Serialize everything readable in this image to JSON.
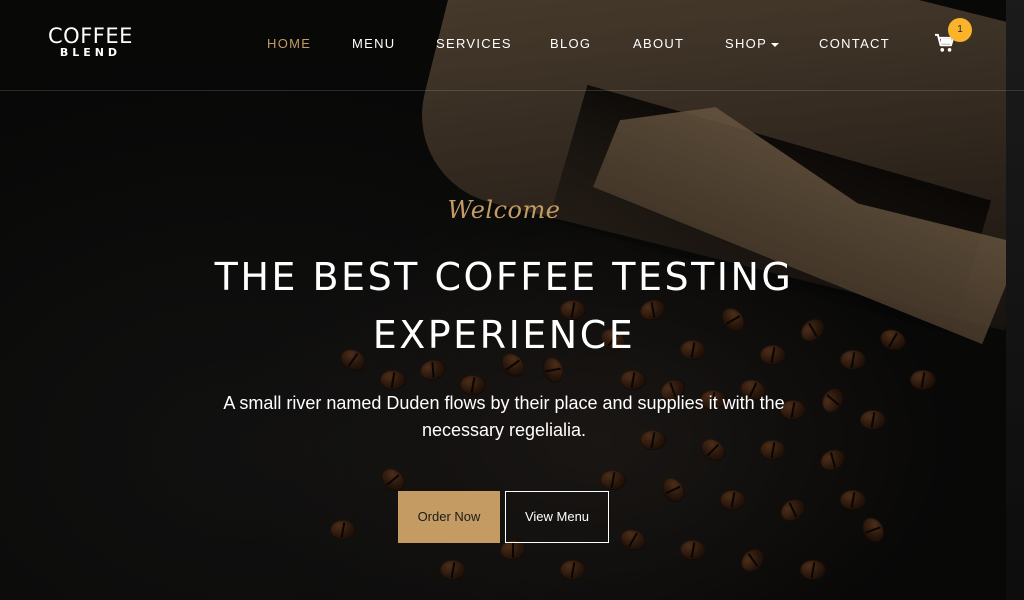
{
  "brand": {
    "name": "COFFEE",
    "tagline": "BLEND"
  },
  "nav": {
    "items": [
      {
        "label": "HOME",
        "active": true
      },
      {
        "label": "MENU",
        "active": false
      },
      {
        "label": "SERVICES",
        "active": false
      },
      {
        "label": "BLOG",
        "active": false
      },
      {
        "label": "ABOUT",
        "active": false
      },
      {
        "label": "SHOP",
        "active": false
      },
      {
        "label": "CONTACT",
        "active": false
      }
    ],
    "cart_count": "1"
  },
  "hero": {
    "welcome": "Welcome",
    "headline": "THE BEST COFFEE TESTING EXPERIENCE",
    "subtitle": "A small river named Duden flows by their place and supplies it with the necessary regelialia.",
    "primary_button": "Order Now",
    "secondary_button": "View Menu"
  },
  "colors": {
    "accent": "#c49b63",
    "badge": "#fbb32b"
  }
}
